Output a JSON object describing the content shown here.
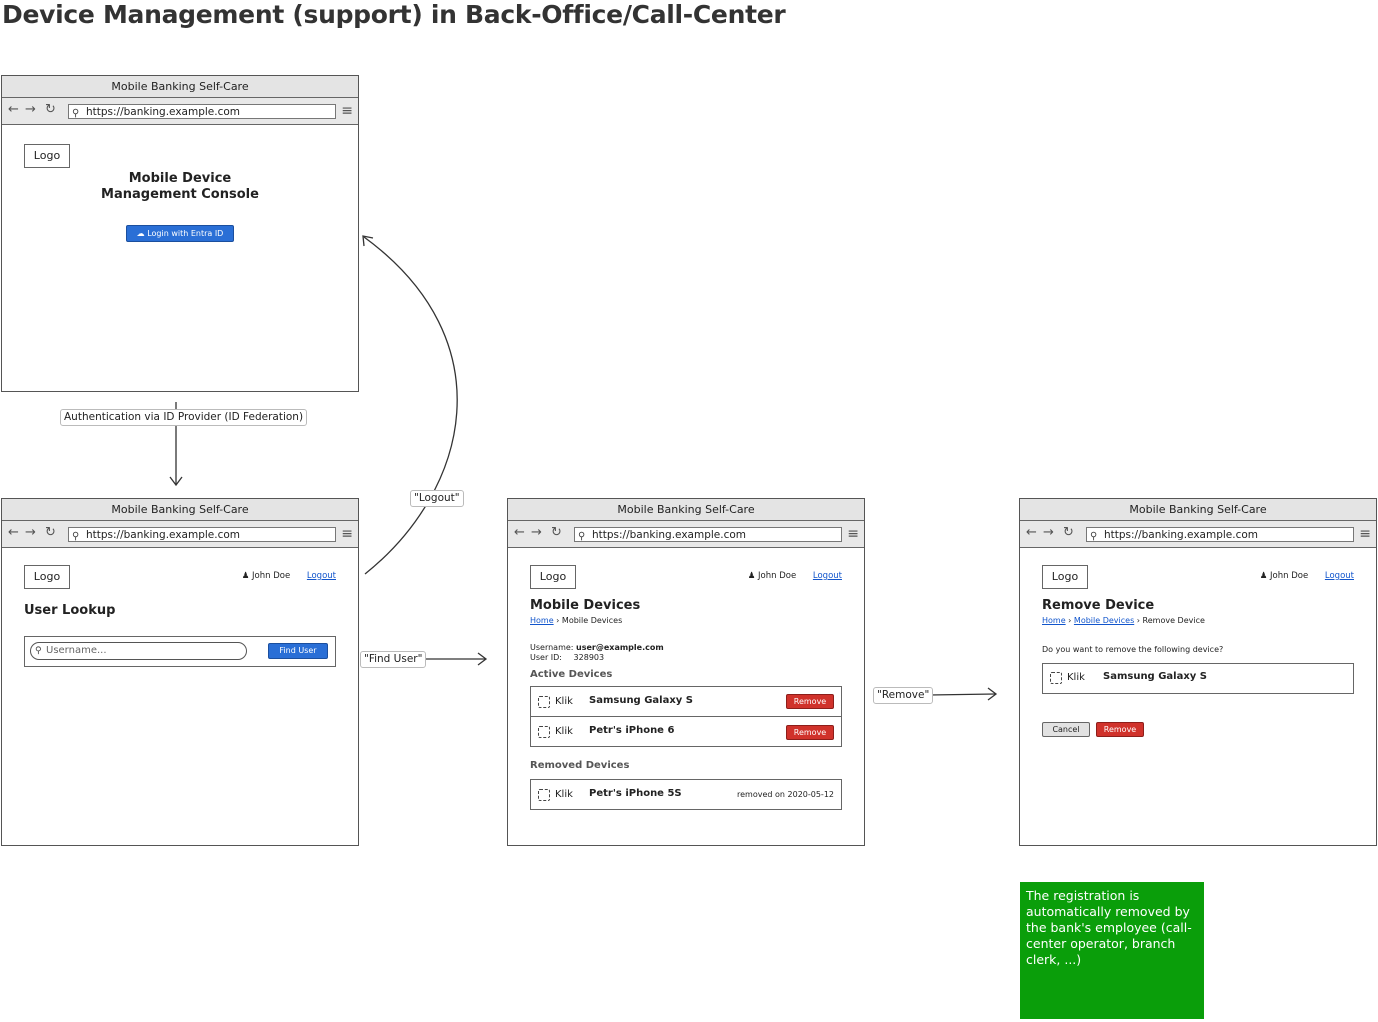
{
  "page_title": "Device Management (support) in Back-Office/Call-Center",
  "browser": {
    "window_title": "Mobile Banking Self-Care",
    "url": "https://banking.example.com"
  },
  "common": {
    "logo": "Logo",
    "user_name": "John Doe",
    "logout": "Logout",
    "home": "Home"
  },
  "screen_login": {
    "heading_line1": "Mobile Device",
    "heading_line2": "Management Console",
    "login_button": "Login with Entra ID"
  },
  "screen_lookup": {
    "heading": "User Lookup",
    "search_placeholder": "Username...",
    "find_button": "Find User"
  },
  "screen_devices": {
    "heading": "Mobile Devices",
    "breadcrumb_current": "Mobile Devices",
    "username_label": "Username:",
    "username_value": "user@example.com",
    "userid_label": "User ID:",
    "userid_value": "328903",
    "active_heading": "Active Devices",
    "active_devices": [
      {
        "app": "Klik",
        "name": "Samsung Galaxy S",
        "action": "Remove"
      },
      {
        "app": "Klik",
        "name": "Petr's iPhone 6",
        "action": "Remove"
      }
    ],
    "removed_heading": "Removed Devices",
    "removed_devices": [
      {
        "app": "Klik",
        "name": "Petr's iPhone 5S",
        "status": "removed on 2020-05-12"
      }
    ]
  },
  "screen_remove": {
    "heading": "Remove Device",
    "breadcrumb_mid": "Mobile Devices",
    "breadcrumb_current": "Remove Device",
    "question": "Do you want to remove the following device?",
    "device_app": "Klik",
    "device_name": "Samsung Galaxy S",
    "cancel_button": "Cancel",
    "remove_button": "Remove"
  },
  "flow_labels": {
    "auth": "Authentication via ID Provider (ID Federation)",
    "logout": "\"Logout\"",
    "find_user": "\"Find User\"",
    "remove": "\"Remove\""
  },
  "note": {
    "text": "The registration is automatically removed by the bank's employee (call-center operator, branch clerk, ...)",
    "color": "#0a9e0a"
  }
}
